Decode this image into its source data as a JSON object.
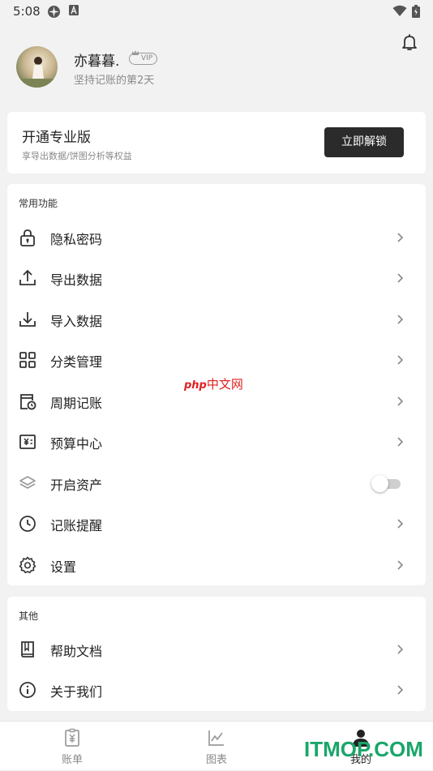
{
  "status_bar": {
    "time": "5:08"
  },
  "profile": {
    "nickname": "亦暮暮.",
    "vip_label": "VIP",
    "days_text": "坚持记账的第2天"
  },
  "pro_card": {
    "title": "开通专业版",
    "subtitle": "享导出数据/饼图分析等权益",
    "button_label": "立即解锁"
  },
  "common_section": {
    "title": "常用功能",
    "items": [
      {
        "label": "隐私密码",
        "icon": "lock-icon"
      },
      {
        "label": "导出数据",
        "icon": "upload-icon"
      },
      {
        "label": "导入数据",
        "icon": "download-icon"
      },
      {
        "label": "分类管理",
        "icon": "grid-icon"
      },
      {
        "label": "周期记账",
        "icon": "calendar-clock-icon"
      },
      {
        "label": "预算中心",
        "icon": "yuan-icon"
      },
      {
        "label": "开启资产",
        "icon": "layers-icon",
        "toggle": false
      },
      {
        "label": "记账提醒",
        "icon": "clock-icon"
      },
      {
        "label": "设置",
        "icon": "gear-icon"
      }
    ]
  },
  "other_section": {
    "title": "其他",
    "items": [
      {
        "label": "帮助文档",
        "icon": "book-icon"
      },
      {
        "label": "关于我们",
        "icon": "info-icon"
      }
    ]
  },
  "watermark": {
    "php": "php",
    "text": "中文网"
  },
  "tab_bar": {
    "tabs": [
      {
        "label": "账单",
        "icon": "bill-icon"
      },
      {
        "label": "图表",
        "icon": "chart-icon"
      },
      {
        "label": "我的",
        "icon": "person-icon",
        "active": true
      }
    ]
  },
  "site_watermark": "ITMOP.COM"
}
